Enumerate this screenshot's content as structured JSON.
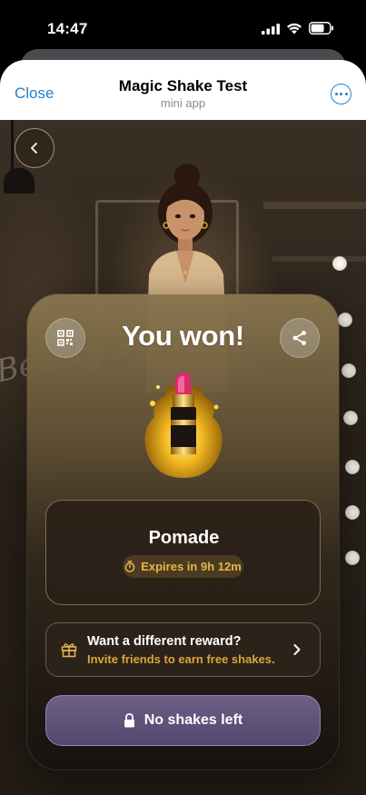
{
  "status_bar": {
    "time": "14:47"
  },
  "header": {
    "close_label": "Close",
    "title": "Magic Shake Test",
    "subtitle": "mini app"
  },
  "scene": {
    "neon_sign": "Beauty Stu"
  },
  "reward": {
    "title": "You won!",
    "prize_name": "Pomade",
    "expiry": "Expires in 9h 12m"
  },
  "invite": {
    "title": "Want a different reward?",
    "subtitle": "Invite friends to earn free shakes."
  },
  "shake_button": {
    "label": "No shakes left"
  },
  "colors": {
    "link_blue": "#2481cc",
    "gold_accent": "#e6b54a",
    "button_purple": "#5e5178"
  },
  "icons": [
    "back-arrow-icon",
    "qr-code-icon",
    "share-icon",
    "timer-icon",
    "gift-icon",
    "chevron-right-icon",
    "lock-icon",
    "more-icon"
  ]
}
